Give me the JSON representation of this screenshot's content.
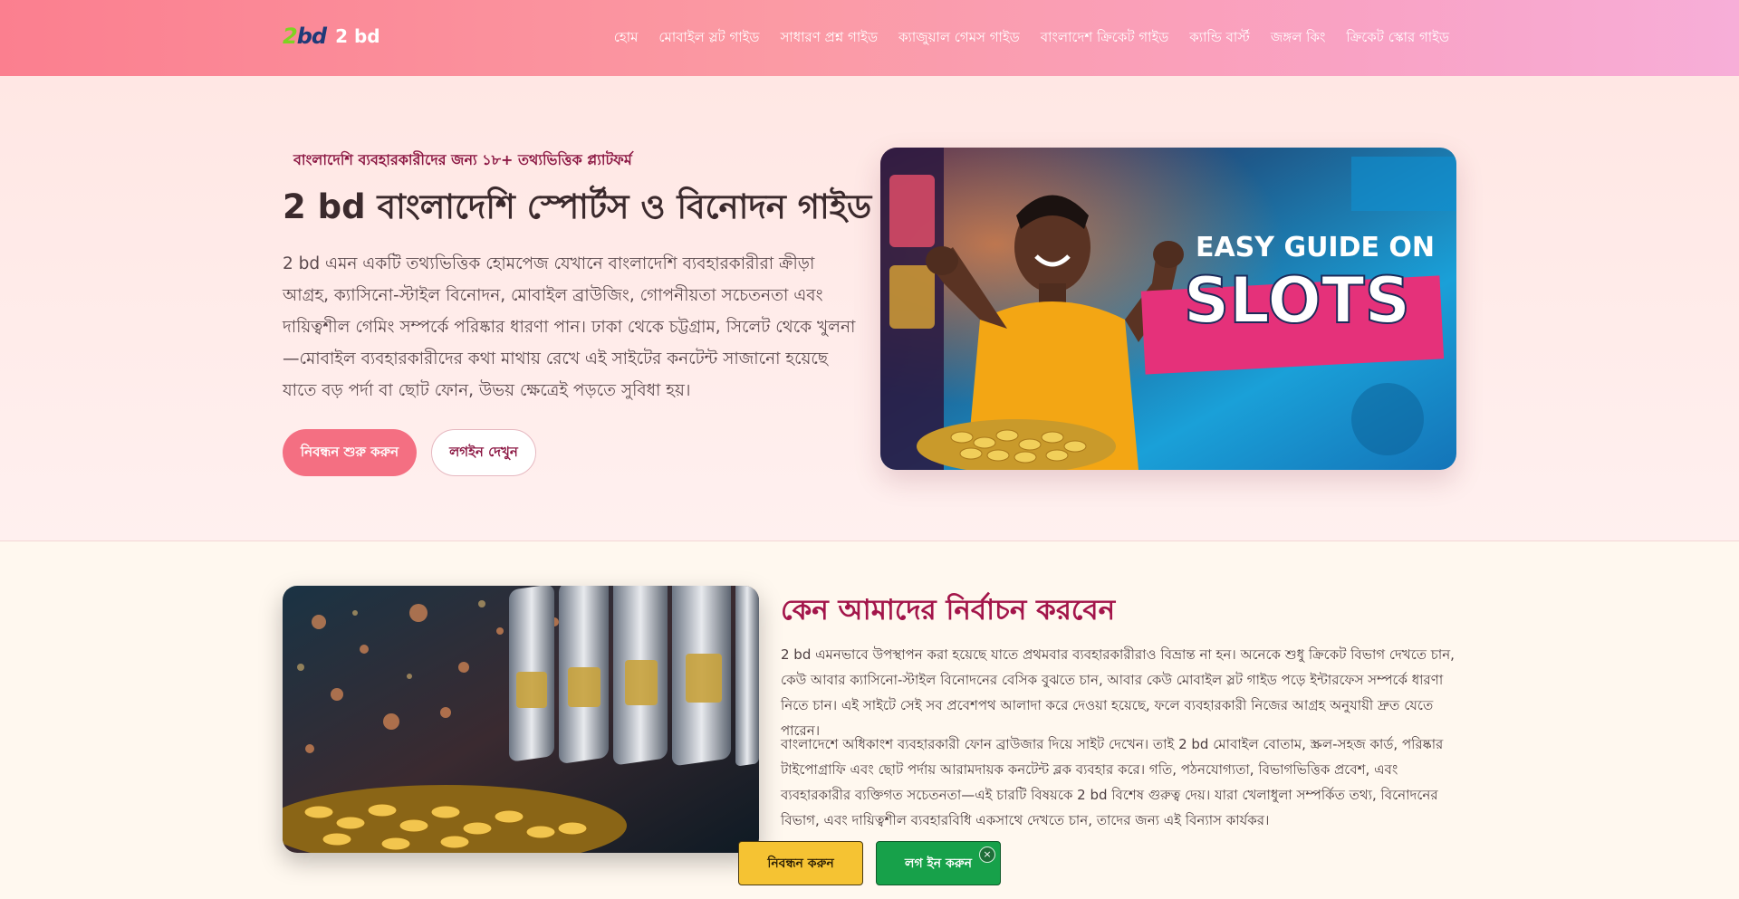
{
  "header": {
    "brand_text": "2 bd",
    "logo_mark": {
      "part1": "2",
      "part2": "bd"
    },
    "nav": [
      "হোম",
      "মোবাইল স্লট গাইড",
      "সাধারণ প্রশ্ন গাইড",
      "ক্যাজুয়াল গেমস গাইড",
      "বাংলাদেশ ক্রিকেট গাইড",
      "ক্যান্ডি বার্স্ট",
      "জঙ্গল কিং",
      "ক্রিকেট স্কোর গাইড"
    ]
  },
  "hero": {
    "eyebrow": "বাংলাদেশি ব্যবহারকারীদের জন্য ১৮+ তথ্যভিত্তিক প্ল্যাটফর্ম",
    "title": "2 bd বাংলাদেশি স্পোর্টস ও বিনোদন গাইড",
    "description": "2 bd এমন একটি তথ্যভিত্তিক হোমপেজ যেখানে বাংলাদেশি ব্যবহারকারীরা ক্রীড়া আগ্রহ, ক্যাসিনো-স্টাইল বিনোদন, মোবাইল ব্রাউজিং, গোপনীয়তা সচেতনতা এবং দায়িত্বশীল গেমিং সম্পর্কে পরিষ্কার ধারণা পান। ঢাকা থেকে চট্টগ্রাম, সিলেট থেকে খুলনা—মোবাইল ব্যবহারকারীদের কথা মাথায় রেখে এই সাইটের কনটেন্ট সাজানো হয়েছে যাতে বড় পর্দা বা ছোট ফোন, উভয় ক্ষেত্রেই পড়তে সুবিধা হয়।",
    "primary_button": "নিবন্ধন শুরু করুন",
    "secondary_button": "লগইন দেখুন",
    "image_text": {
      "line1": "EASY GUIDE ON",
      "line2": "SLOTS"
    }
  },
  "why": {
    "title": "কেন আমাদের নির্বাচন করবেন",
    "p1": "2 bd এমনভাবে উপস্থাপন করা হয়েছে যাতে প্রথমবার ব্যবহারকারীরাও বিভ্রান্ত না হন। অনেকে শুধু ক্রিকেট বিভাগ দেখতে চান, কেউ আবার ক্যাসিনো-স্টাইল বিনোদনের বেসিক বুঝতে চান, আবার কেউ মোবাইল স্লট গাইড পড়ে ইন্টারফেস সম্পর্কে ধারণা নিতে চান। এই সাইটে সেই সব প্রবেশপথ আলাদা করে দেওয়া হয়েছে, ফলে ব্যবহারকারী নিজের আগ্রহ অনুযায়ী দ্রুত যেতে পারেন।",
    "p2": "বাংলাদেশে অধিকাংশ ব্যবহারকারী ফোন ব্রাউজার দিয়ে সাইট দেখেন। তাই 2 bd মোবাইল বোতাম, স্ক্রল-সহজ কার্ড, পরিষ্কার টাইপোগ্রাফি এবং ছোট পর্দায় আরামদায়ক কনটেন্ট ব্লক ব্যবহার করে। গতি, পঠনযোগ্যতা, বিভাগভিত্তিক প্রবেশ, এবং ব্যবহারকারীর ব্যক্তিগত সচেতনতা—এই চারটি বিষয়কে 2 bd বিশেষ গুরুত্ব দেয়। যারা খেলাধুলা সম্পর্কিত তথ্য, বিনোদনের বিভাগ, এবং দায়িত্বশীল ব্যবহারবিধি একসাথে দেখতে চান, তাদের জন্য এই বিন্যাস কার্যকর।"
  },
  "sticky_bar": {
    "register": "নিবন্ধন করুন",
    "login": "লগ ইন করুন",
    "close_icon": "×"
  }
}
